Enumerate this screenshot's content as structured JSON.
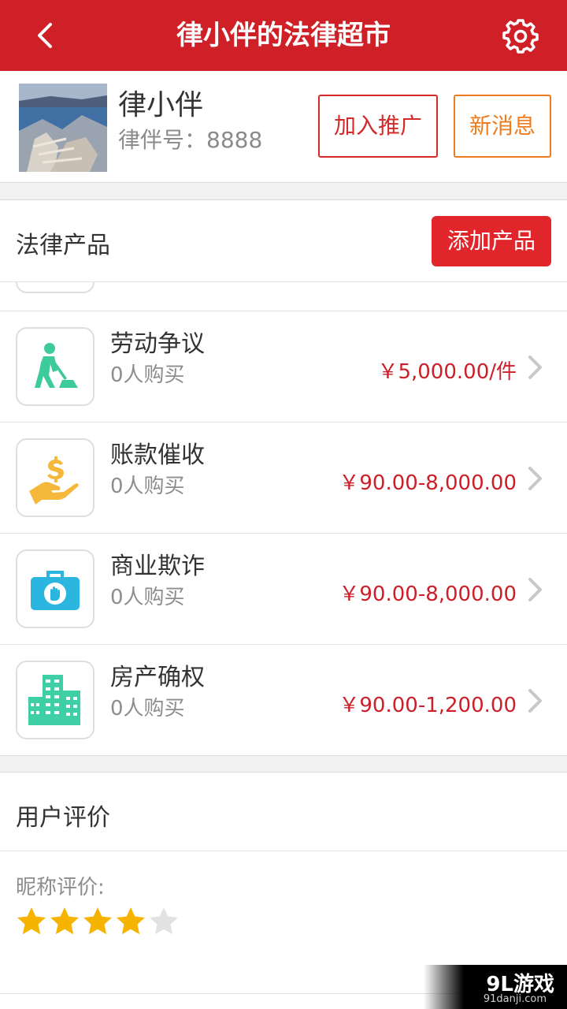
{
  "header": {
    "title": "律小伴的法律超市",
    "back_icon": "chevron-left-icon",
    "settings_icon": "gear-icon",
    "bg_color": "#cf2027"
  },
  "profile": {
    "name": "律小伴",
    "id_label": "律伴号：8888",
    "promote_button": "加入推广",
    "messages_button": "新消息"
  },
  "products": {
    "section_title": "法律产品",
    "add_button": "添加产品",
    "items": [
      {
        "name": "劳动争议",
        "buyers": "0人购买",
        "price": "￥5,000.00/件",
        "icon": "worker-digging-icon",
        "icon_color": "#3ecb9a"
      },
      {
        "name": "账款催收",
        "buyers": "0人购买",
        "price": "￥90.00-8,000.00",
        "icon": "hand-money-icon",
        "icon_color": "#f6b83a"
      },
      {
        "name": "商业欺诈",
        "buyers": "0人购买",
        "price": "￥90.00-8,000.00",
        "icon": "briefcase-hand-icon",
        "icon_color": "#2bb6e0"
      },
      {
        "name": "房产确权",
        "buyers": "0人购买",
        "price": "￥90.00-1,200.00",
        "icon": "buildings-icon",
        "icon_color": "#3ecfa5"
      }
    ]
  },
  "reviews": {
    "section_title": "用户评价",
    "nickname_label": "昵称评价:",
    "rating": 4,
    "rating_max": 5
  },
  "watermark": {
    "text": "9L游戏",
    "sub": "91danji.com"
  }
}
